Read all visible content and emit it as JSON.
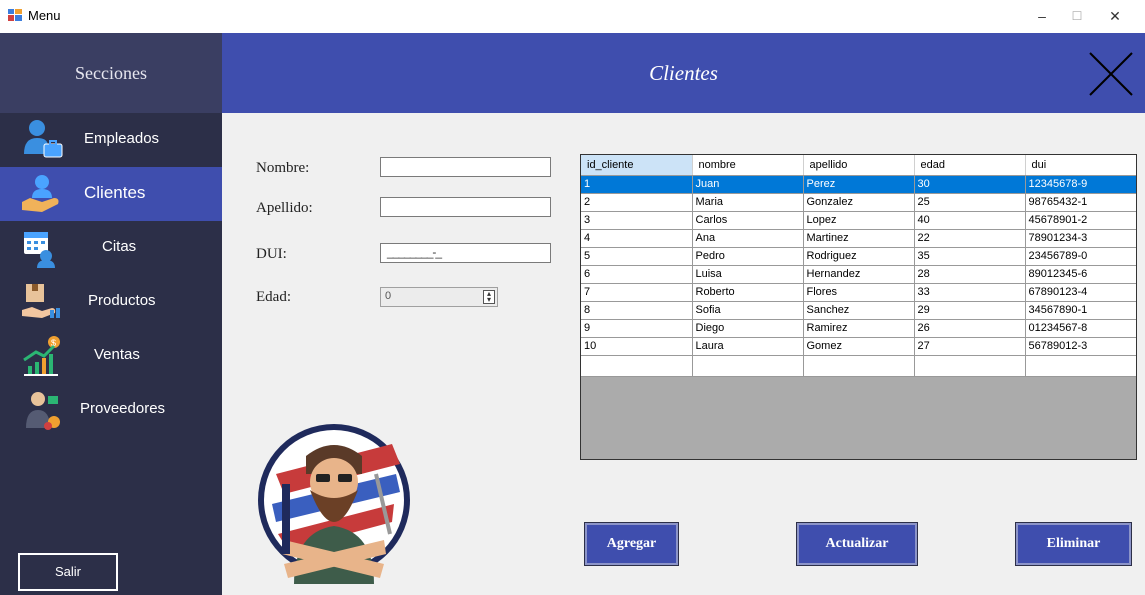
{
  "window": {
    "title": "Menu",
    "minimize": "–",
    "maximize": "☐",
    "close": "✕"
  },
  "sidebar": {
    "header": "Secciones",
    "items": [
      {
        "label": "Empleados",
        "icon": "employee-icon"
      },
      {
        "label": "Clientes",
        "icon": "client-icon",
        "active": true
      },
      {
        "label": "Citas",
        "icon": "calendar-icon"
      },
      {
        "label": "Productos",
        "icon": "product-box-icon"
      },
      {
        "label": "Ventas",
        "icon": "sales-chart-icon"
      },
      {
        "label": "Proveedores",
        "icon": "supplier-icon"
      }
    ],
    "exit_label": "Salir"
  },
  "header": {
    "title": "Clientes"
  },
  "form": {
    "nombre": {
      "label": "Nombre:",
      "value": ""
    },
    "apellido": {
      "label": "Apellido:",
      "value": ""
    },
    "dui": {
      "label": "DUI:",
      "value": "________-_"
    },
    "edad": {
      "label": "Edad:",
      "value": "0"
    }
  },
  "table": {
    "columns": [
      "id_cliente",
      "nombre",
      "apellido",
      "edad",
      "dui"
    ],
    "rows": [
      [
        "1",
        "Juan",
        "Perez",
        "30",
        "12345678-9"
      ],
      [
        "2",
        "Maria",
        "Gonzalez",
        "25",
        "98765432-1"
      ],
      [
        "3",
        "Carlos",
        "Lopez",
        "40",
        "45678901-2"
      ],
      [
        "4",
        "Ana",
        "Martinez",
        "22",
        "78901234-3"
      ],
      [
        "5",
        "Pedro",
        "Rodriguez",
        "35",
        "23456789-0"
      ],
      [
        "6",
        "Luisa",
        "Hernandez",
        "28",
        "89012345-6"
      ],
      [
        "7",
        "Roberto",
        "Flores",
        "33",
        "67890123-4"
      ],
      [
        "8",
        "Sofia",
        "Sanchez",
        "29",
        "34567890-1"
      ],
      [
        "9",
        "Diego",
        "Ramirez",
        "26",
        "01234567-8"
      ],
      [
        "10",
        "Laura",
        "Gomez",
        "27",
        "56789012-3"
      ]
    ],
    "selected_row": 0
  },
  "buttons": {
    "add": "Agregar",
    "update": "Actualizar",
    "delete": "Eliminar"
  },
  "colors": {
    "accent": "#3f4eae",
    "sidebar": "#2c2f48",
    "selection": "#0078d7"
  }
}
